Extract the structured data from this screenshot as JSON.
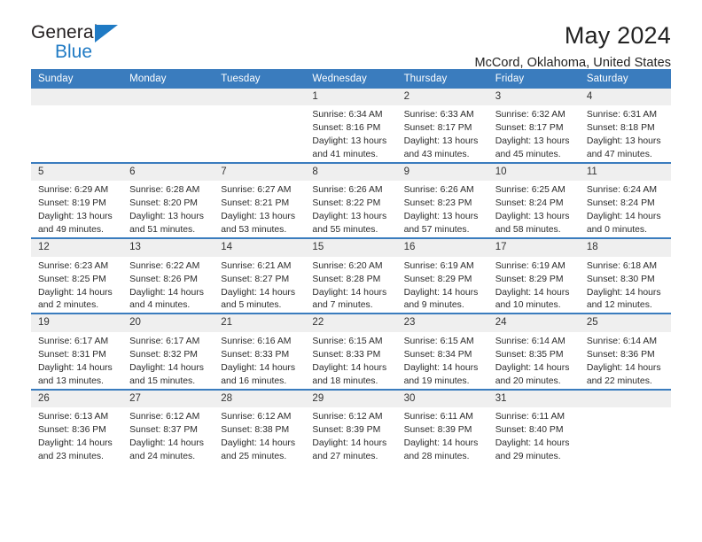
{
  "branding": {
    "logo_top": "General",
    "logo_bottom": "Blue",
    "accent_color": "#1f7ac4"
  },
  "header": {
    "title": "May 2024",
    "subtitle": "McCord, Oklahoma, United States"
  },
  "theme": {
    "header_row_bg": "#3a7cbe",
    "header_row_text": "#ffffff",
    "daynum_bg": "#efefef",
    "body_text": "#2b2b2b"
  },
  "weekday_headers": [
    "Sunday",
    "Monday",
    "Tuesday",
    "Wednesday",
    "Thursday",
    "Friday",
    "Saturday"
  ],
  "labels": {
    "sunrise_prefix": "Sunrise:",
    "sunset_prefix": "Sunset:",
    "daylight_prefix": "Daylight:"
  },
  "weeks": [
    [
      {
        "day": "",
        "empty": true,
        "sunrise": "",
        "sunset": "",
        "daylight": ""
      },
      {
        "day": "",
        "empty": true,
        "sunrise": "",
        "sunset": "",
        "daylight": ""
      },
      {
        "day": "",
        "empty": true,
        "sunrise": "",
        "sunset": "",
        "daylight": ""
      },
      {
        "day": "1",
        "empty": false,
        "sunrise": "Sunrise: 6:34 AM",
        "sunset": "Sunset: 8:16 PM",
        "daylight": "Daylight: 13 hours and 41 minutes."
      },
      {
        "day": "2",
        "empty": false,
        "sunrise": "Sunrise: 6:33 AM",
        "sunset": "Sunset: 8:17 PM",
        "daylight": "Daylight: 13 hours and 43 minutes."
      },
      {
        "day": "3",
        "empty": false,
        "sunrise": "Sunrise: 6:32 AM",
        "sunset": "Sunset: 8:17 PM",
        "daylight": "Daylight: 13 hours and 45 minutes."
      },
      {
        "day": "4",
        "empty": false,
        "sunrise": "Sunrise: 6:31 AM",
        "sunset": "Sunset: 8:18 PM",
        "daylight": "Daylight: 13 hours and 47 minutes."
      }
    ],
    [
      {
        "day": "5",
        "empty": false,
        "sunrise": "Sunrise: 6:29 AM",
        "sunset": "Sunset: 8:19 PM",
        "daylight": "Daylight: 13 hours and 49 minutes."
      },
      {
        "day": "6",
        "empty": false,
        "sunrise": "Sunrise: 6:28 AM",
        "sunset": "Sunset: 8:20 PM",
        "daylight": "Daylight: 13 hours and 51 minutes."
      },
      {
        "day": "7",
        "empty": false,
        "sunrise": "Sunrise: 6:27 AM",
        "sunset": "Sunset: 8:21 PM",
        "daylight": "Daylight: 13 hours and 53 minutes."
      },
      {
        "day": "8",
        "empty": false,
        "sunrise": "Sunrise: 6:26 AM",
        "sunset": "Sunset: 8:22 PM",
        "daylight": "Daylight: 13 hours and 55 minutes."
      },
      {
        "day": "9",
        "empty": false,
        "sunrise": "Sunrise: 6:26 AM",
        "sunset": "Sunset: 8:23 PM",
        "daylight": "Daylight: 13 hours and 57 minutes."
      },
      {
        "day": "10",
        "empty": false,
        "sunrise": "Sunrise: 6:25 AM",
        "sunset": "Sunset: 8:24 PM",
        "daylight": "Daylight: 13 hours and 58 minutes."
      },
      {
        "day": "11",
        "empty": false,
        "sunrise": "Sunrise: 6:24 AM",
        "sunset": "Sunset: 8:24 PM",
        "daylight": "Daylight: 14 hours and 0 minutes."
      }
    ],
    [
      {
        "day": "12",
        "empty": false,
        "sunrise": "Sunrise: 6:23 AM",
        "sunset": "Sunset: 8:25 PM",
        "daylight": "Daylight: 14 hours and 2 minutes."
      },
      {
        "day": "13",
        "empty": false,
        "sunrise": "Sunrise: 6:22 AM",
        "sunset": "Sunset: 8:26 PM",
        "daylight": "Daylight: 14 hours and 4 minutes."
      },
      {
        "day": "14",
        "empty": false,
        "sunrise": "Sunrise: 6:21 AM",
        "sunset": "Sunset: 8:27 PM",
        "daylight": "Daylight: 14 hours and 5 minutes."
      },
      {
        "day": "15",
        "empty": false,
        "sunrise": "Sunrise: 6:20 AM",
        "sunset": "Sunset: 8:28 PM",
        "daylight": "Daylight: 14 hours and 7 minutes."
      },
      {
        "day": "16",
        "empty": false,
        "sunrise": "Sunrise: 6:19 AM",
        "sunset": "Sunset: 8:29 PM",
        "daylight": "Daylight: 14 hours and 9 minutes."
      },
      {
        "day": "17",
        "empty": false,
        "sunrise": "Sunrise: 6:19 AM",
        "sunset": "Sunset: 8:29 PM",
        "daylight": "Daylight: 14 hours and 10 minutes."
      },
      {
        "day": "18",
        "empty": false,
        "sunrise": "Sunrise: 6:18 AM",
        "sunset": "Sunset: 8:30 PM",
        "daylight": "Daylight: 14 hours and 12 minutes."
      }
    ],
    [
      {
        "day": "19",
        "empty": false,
        "sunrise": "Sunrise: 6:17 AM",
        "sunset": "Sunset: 8:31 PM",
        "daylight": "Daylight: 14 hours and 13 minutes."
      },
      {
        "day": "20",
        "empty": false,
        "sunrise": "Sunrise: 6:17 AM",
        "sunset": "Sunset: 8:32 PM",
        "daylight": "Daylight: 14 hours and 15 minutes."
      },
      {
        "day": "21",
        "empty": false,
        "sunrise": "Sunrise: 6:16 AM",
        "sunset": "Sunset: 8:33 PM",
        "daylight": "Daylight: 14 hours and 16 minutes."
      },
      {
        "day": "22",
        "empty": false,
        "sunrise": "Sunrise: 6:15 AM",
        "sunset": "Sunset: 8:33 PM",
        "daylight": "Daylight: 14 hours and 18 minutes."
      },
      {
        "day": "23",
        "empty": false,
        "sunrise": "Sunrise: 6:15 AM",
        "sunset": "Sunset: 8:34 PM",
        "daylight": "Daylight: 14 hours and 19 minutes."
      },
      {
        "day": "24",
        "empty": false,
        "sunrise": "Sunrise: 6:14 AM",
        "sunset": "Sunset: 8:35 PM",
        "daylight": "Daylight: 14 hours and 20 minutes."
      },
      {
        "day": "25",
        "empty": false,
        "sunrise": "Sunrise: 6:14 AM",
        "sunset": "Sunset: 8:36 PM",
        "daylight": "Daylight: 14 hours and 22 minutes."
      }
    ],
    [
      {
        "day": "26",
        "empty": false,
        "sunrise": "Sunrise: 6:13 AM",
        "sunset": "Sunset: 8:36 PM",
        "daylight": "Daylight: 14 hours and 23 minutes."
      },
      {
        "day": "27",
        "empty": false,
        "sunrise": "Sunrise: 6:12 AM",
        "sunset": "Sunset: 8:37 PM",
        "daylight": "Daylight: 14 hours and 24 minutes."
      },
      {
        "day": "28",
        "empty": false,
        "sunrise": "Sunrise: 6:12 AM",
        "sunset": "Sunset: 8:38 PM",
        "daylight": "Daylight: 14 hours and 25 minutes."
      },
      {
        "day": "29",
        "empty": false,
        "sunrise": "Sunrise: 6:12 AM",
        "sunset": "Sunset: 8:39 PM",
        "daylight": "Daylight: 14 hours and 27 minutes."
      },
      {
        "day": "30",
        "empty": false,
        "sunrise": "Sunrise: 6:11 AM",
        "sunset": "Sunset: 8:39 PM",
        "daylight": "Daylight: 14 hours and 28 minutes."
      },
      {
        "day": "31",
        "empty": false,
        "sunrise": "Sunrise: 6:11 AM",
        "sunset": "Sunset: 8:40 PM",
        "daylight": "Daylight: 14 hours and 29 minutes."
      },
      {
        "day": "",
        "empty": true,
        "sunrise": "",
        "sunset": "",
        "daylight": ""
      }
    ]
  ]
}
